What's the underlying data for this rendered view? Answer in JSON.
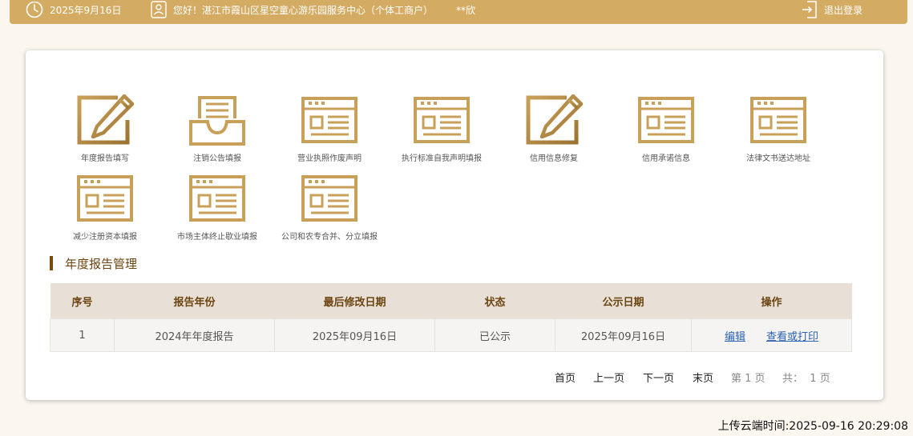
{
  "header": {
    "date": "2025年9月16日",
    "greeting": "您好！湛江市霞山区星空童心游乐园服务中心（个体工商户）",
    "user": "**欣",
    "logout_label": "退出登录"
  },
  "tiles": [
    {
      "label": "年度报告填写",
      "icon": "edit-form-icon"
    },
    {
      "label": "注销公告填报",
      "icon": "inbox-tray-icon"
    },
    {
      "label": "营业执照作废声明",
      "icon": "document-form-icon"
    },
    {
      "label": "执行标准自我声明填报",
      "icon": "document-form-icon"
    },
    {
      "label": "信用信息修复",
      "icon": "edit-form-icon"
    },
    {
      "label": "信用承诺信息",
      "icon": "document-form-icon"
    },
    {
      "label": "法律文书送达地址",
      "icon": "document-form-icon"
    },
    {
      "label": "减少注册资本填报",
      "icon": "document-form-icon"
    },
    {
      "label": "市场主体终止歇业填报",
      "icon": "document-form-icon"
    },
    {
      "label": "公司和农专合并、分立填报",
      "icon": "document-form-icon"
    }
  ],
  "section": {
    "title": "年度报告管理"
  },
  "table": {
    "headers": [
      "序号",
      "报告年份",
      "最后修改日期",
      "状态",
      "公示日期",
      "操作"
    ],
    "rows": [
      {
        "index": "1",
        "year": "2024年年度报告",
        "modified": "2025年09月16日",
        "status": "已公示",
        "publish_date": "2025年09月16日",
        "edit_label": "编辑",
        "print_label": "查看或打印"
      }
    ]
  },
  "pagination": {
    "first": "首页",
    "prev": "上一页",
    "next": "下一页",
    "last": "末页",
    "current": "第 1 页",
    "total": "共：  1 页"
  },
  "footer": {
    "upload_time": "上传云端时间:2025-09-16 20:29:08"
  },
  "colors": {
    "header_bg": "#d4ab63",
    "icon_gold": "#c8a05a",
    "icon_dark": "#a57a2e",
    "title_brown": "#6b4410",
    "link_blue": "#2a62b4"
  }
}
